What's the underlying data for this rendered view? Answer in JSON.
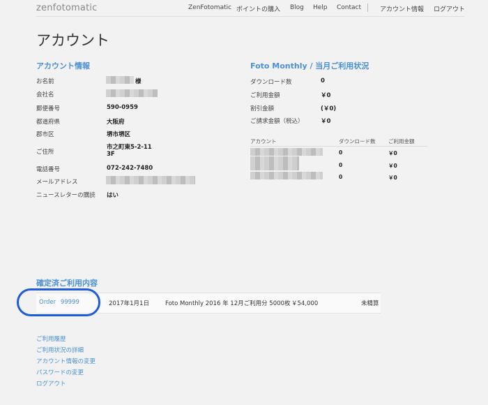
{
  "header": {
    "logo_text": "zenfotomatic",
    "nav_items": [
      "ZenFotomatic",
      "ポイントの購入",
      "Blog",
      "Help",
      "Contact"
    ],
    "nav_right": [
      "アカウント情報",
      "ログアウト"
    ]
  },
  "page_title": "アカウント",
  "account_info": {
    "title": "アカウント情報",
    "name": {
      "label": "お名前",
      "suffix": "様"
    },
    "company": {
      "label": "会社名"
    },
    "postal": {
      "label": "郵便番号",
      "value": "590-0959"
    },
    "prefecture": {
      "label": "都道府県",
      "value": "大阪府"
    },
    "city": {
      "label": "郡市区",
      "value": "堺市堺区"
    },
    "address": {
      "label": "ご住所",
      "value_line1": "市之町東5-2-11",
      "value_line2": "3F"
    },
    "phone": {
      "label": "電話番号",
      "value": "072-242-7480"
    },
    "email": {
      "label": "メールアドレス"
    },
    "newsletter": {
      "label": "ニュースレターの購読",
      "value": "はい"
    }
  },
  "monthly_usage": {
    "title": "Foto Monthly / 当月ご利用状況",
    "rows": [
      {
        "label": "ダウンロード数",
        "value": "0"
      },
      {
        "label": "ご利用金額",
        "value": "￥0"
      },
      {
        "label": "割引金額",
        "value": "(￥0)"
      },
      {
        "label": "ご請求金額（税込）",
        "value": "￥0"
      }
    ],
    "table": {
      "headers": [
        "アカウント",
        "ダウンロード数",
        "ご利用金額"
      ],
      "rows": [
        {
          "downloads": "0",
          "amount": "￥0"
        },
        {
          "downloads": "0",
          "amount": "￥0"
        },
        {
          "downloads": "0",
          "amount": "￥0"
        }
      ]
    }
  },
  "confirmed": {
    "title": "確定済ご利用内容",
    "order": {
      "order_label": "Order",
      "order_number": "99999",
      "date": "2017年1月1日",
      "description": "Foto Monthly 2016 年 12月ご利用分 5000枚",
      "amount": "￥54,000",
      "status": "未精算"
    }
  },
  "footer_links": [
    "ご利用履歴",
    "ご利用状況の詳細",
    "アカウント情報の変更",
    "パスワードの変更",
    "ログアウト"
  ],
  "colors": {
    "accent": "#4a90d9",
    "highlight_ring": "#1d5bd9",
    "background": "#f2f2f2"
  }
}
